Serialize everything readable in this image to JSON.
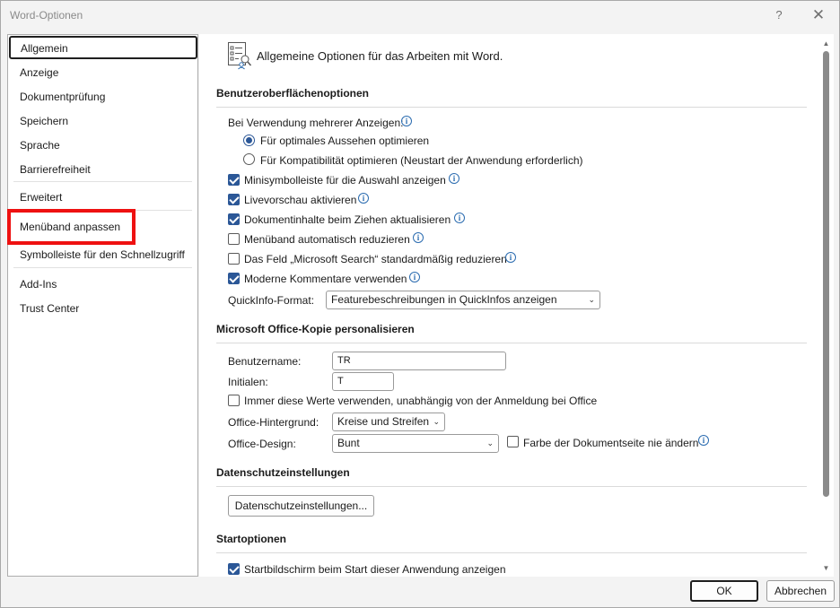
{
  "window": {
    "title": "Word-Optionen",
    "help_label": "?",
    "close_label": "✕"
  },
  "nav": {
    "items": [
      {
        "label": "Allgemein"
      },
      {
        "label": "Anzeige"
      },
      {
        "label": "Dokumentprüfung"
      },
      {
        "label": "Speichern"
      },
      {
        "label": "Sprache"
      },
      {
        "label": "Barrierefreiheit"
      },
      {
        "label": "Erweitert"
      },
      {
        "label": "Menüband anpassen"
      },
      {
        "label": "Symbolleiste für den Schnellzugriff"
      },
      {
        "label": "Add-Ins"
      },
      {
        "label": "Trust Center"
      }
    ],
    "selected": "Allgemein"
  },
  "content": {
    "header": "Allgemeine Optionen für das Arbeiten mit Word.",
    "ui_section": {
      "title": "Benutzeroberflächenoptionen",
      "multi_display_label": "Bei Verwendung mehrerer Anzeigen:",
      "radio_optimal": "Für optimales Aussehen optimieren",
      "radio_compat": "Für Kompatibilität optimieren (Neustart der Anwendung erforderlich)",
      "cb_minitoolbar": "Minisymbolleiste für die Auswahl anzeigen",
      "cb_livepreview": "Livevorschau aktivieren",
      "cb_update_drag": "Dokumentinhalte beim Ziehen aktualisieren",
      "cb_collapse_ribbon": "Menüband automatisch reduzieren",
      "cb_collapse_search": "Das Feld „Microsoft Search“ standardmäßig reduzieren",
      "cb_modern_comments": "Moderne Kommentare verwenden",
      "screentip_label": "QuickInfo-Format:",
      "screentip_value": "Featurebeschreibungen in QuickInfos anzeigen"
    },
    "personalize_section": {
      "title": "Microsoft Office-Kopie personalisieren",
      "username_label": "Benutzername:",
      "username_value": "TR",
      "initials_label": "Initialen:",
      "initials_value": "T",
      "always_use_label": "Immer diese Werte verwenden, unabhängig von der Anmeldung bei Office",
      "background_label": "Office-Hintergrund:",
      "background_value": "Kreise und Streifen",
      "theme_label": "Office-Design:",
      "theme_value": "Bunt",
      "never_change_label": "Farbe der Dokumentseite nie ändern"
    },
    "privacy_section": {
      "title": "Datenschutzeinstellungen",
      "button_label": "Datenschutzeinstellungen..."
    },
    "startup_section": {
      "title": "Startoptionen",
      "cb_start_screen": "Startbildschirm beim Start dieser Anwendung anzeigen"
    }
  },
  "footer": {
    "ok_label": "OK",
    "cancel_label": "Abbrechen"
  },
  "state": {
    "radio_selected": "optimal",
    "checked": [
      "minitoolbar",
      "livepreview",
      "update_drag",
      "modern_comments",
      "start_screen"
    ],
    "unchecked": [
      "collapse_ribbon",
      "collapse_search",
      "always_use",
      "never_change"
    ]
  },
  "colors": {
    "accent": "#2b5797",
    "highlight_box": "#e11111",
    "info_icon": "#2b6cb0"
  }
}
